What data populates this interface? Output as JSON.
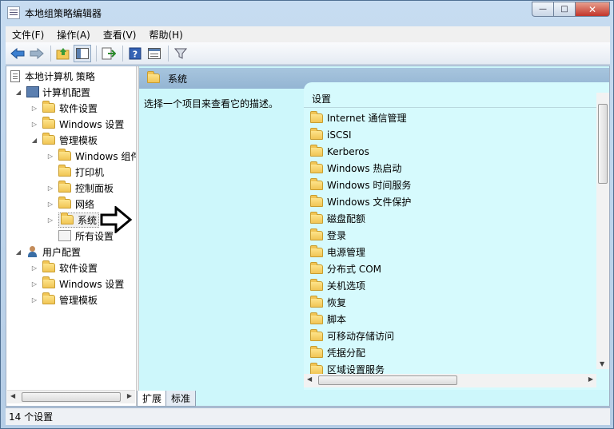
{
  "window": {
    "title": "本地组策略编辑器"
  },
  "menu": [
    "文件(F)",
    "操作(A)",
    "查看(V)",
    "帮助(H)"
  ],
  "toolbar": {
    "icons": [
      "back-icon",
      "forward-icon",
      "up-folder-icon",
      "show-tree-icon",
      "export-list-icon",
      "help-icon",
      "properties-icon",
      "filter-icon"
    ]
  },
  "tree": {
    "root": "本地计算机 策略",
    "computer_config": "计算机配置",
    "comp_software": "软件设置",
    "comp_windows": "Windows 设置",
    "comp_admin": "管理模板",
    "admin_windows": "Windows 组件",
    "admin_printers": "打印机",
    "admin_control": "控制面板",
    "admin_network": "网络",
    "admin_system": "系统",
    "admin_all": "所有设置",
    "user_config": "用户配置",
    "user_software": "软件设置",
    "user_windows": "Windows 设置",
    "user_admin": "管理模板"
  },
  "right": {
    "header": "系统",
    "description": "选择一个项目来查看它的描述。",
    "column_header": "设置",
    "items": [
      "Internet 通信管理",
      "iSCSI",
      "Kerberos",
      "Windows 热启动",
      "Windows 时间服务",
      "Windows 文件保护",
      "磁盘配额",
      "登录",
      "电源管理",
      "分布式 COM",
      "关机选项",
      "恢复",
      "脚本",
      "可移动存储访问",
      "凭据分配",
      "区域设置服务"
    ]
  },
  "tabs": [
    "扩展",
    "标准"
  ],
  "status": "14 个设置",
  "colors": {
    "panel_bg": "#cdf7fb",
    "header_bg": "#9ab9d6"
  }
}
